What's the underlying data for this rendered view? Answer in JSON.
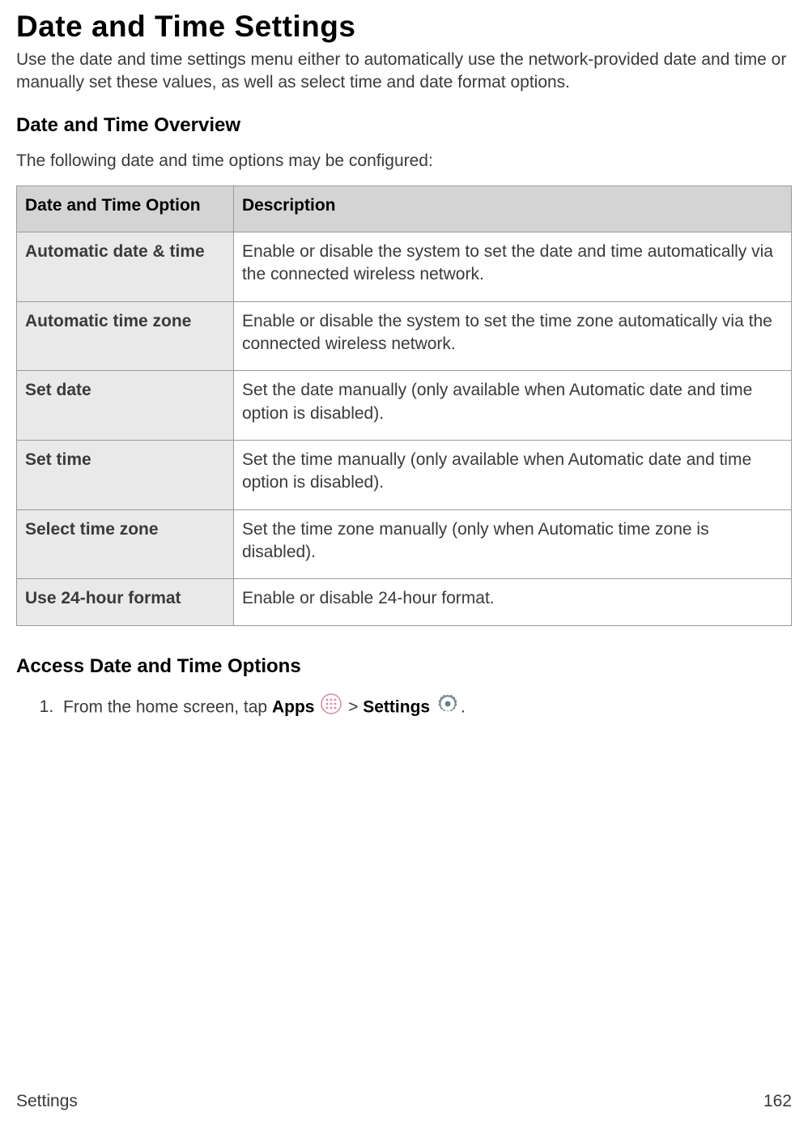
{
  "title": "Date and Time Settings",
  "intro": "Use the date and time settings menu either to automatically use the network-provided date and time or manually set these values, as well as select time and date format options.",
  "overview_heading": "Date and Time Overview",
  "overview_lead": "The following date and time options may be configured:",
  "table": {
    "headers": [
      "Date and Time Option",
      "Description"
    ],
    "rows": [
      {
        "option": "Automatic date & time",
        "description": "Enable or disable the system to set the date and time automatically via the connected wireless network."
      },
      {
        "option": "Automatic time zone",
        "description": "Enable or disable the system to set the time zone automatically via the connected wireless network."
      },
      {
        "option": "Set date",
        "description": "Set the date manually (only available when Automatic date and time option is disabled)."
      },
      {
        "option": "Set time",
        "description": "Set the time manually (only available when Automatic date and time option is disabled)."
      },
      {
        "option": "Select time zone",
        "description": "Set the time zone manually (only when Automatic time zone is disabled)."
      },
      {
        "option": "Use 24-hour format",
        "description": "Enable or disable 24-hour format."
      }
    ]
  },
  "access_heading": "Access Date and Time Options",
  "step1": {
    "prefix": "From the home screen, tap ",
    "apps_label": "Apps",
    "separator": " > ",
    "settings_label": "Settings",
    "suffix": "."
  },
  "icons": {
    "apps": "apps-icon",
    "settings": "settings-icon"
  },
  "footer": {
    "section": "Settings",
    "page": "162"
  }
}
